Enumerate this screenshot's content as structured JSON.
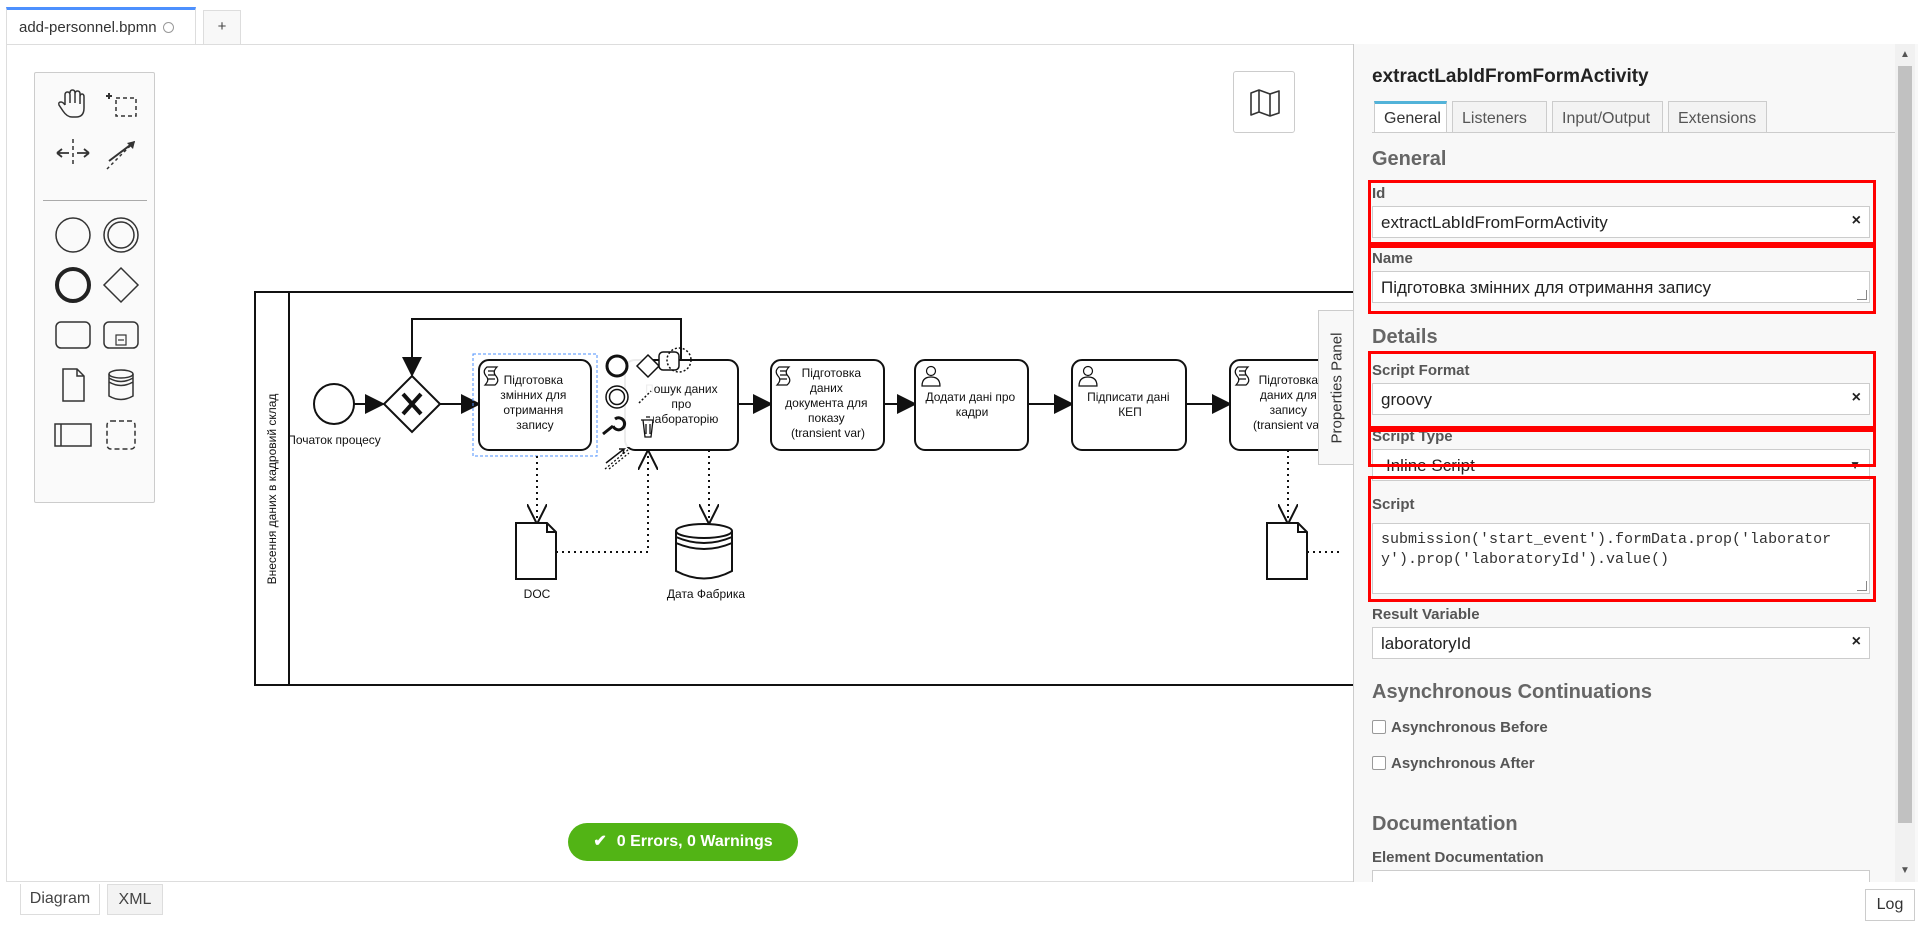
{
  "tabs": {
    "file_name": "add-personnel.bpmn",
    "add_label": "+"
  },
  "palette": {
    "tools": [
      "hand-tool",
      "lasso-tool",
      "space-tool",
      "connect-tool",
      "start-event",
      "intermediate-event",
      "end-event",
      "gateway",
      "task",
      "subprocess",
      "data-object",
      "data-store",
      "pool",
      "group"
    ]
  },
  "diagram": {
    "lane_label": "Внесення даних в кадровий склад",
    "start_event_label": "Початок процесу",
    "task1": [
      "Підготовка",
      "змінних для",
      "отримання",
      "запису"
    ],
    "task2": [
      "Пошук даних",
      "про",
      "лабораторію"
    ],
    "task3": [
      "Підготовка",
      "даних",
      "документа для",
      "показу",
      "(transient var)"
    ],
    "task4": [
      "Додати дані про",
      "кадри"
    ],
    "task5": [
      "Підписати дані",
      "КЕП"
    ],
    "task6": [
      "Підготовка",
      "даних для",
      "запису",
      "(transient var)"
    ],
    "doc_label": "DOC",
    "datastore_label": "Дата Фабрика"
  },
  "status": {
    "text": "0 Errors, 0 Warnings",
    "color": "#52b415"
  },
  "properties_toggle": "Properties Panel",
  "panel": {
    "title": "extractLabIdFromFormActivity",
    "tabs": [
      "General",
      "Listeners",
      "Input/Output",
      "Extensions"
    ],
    "active_tab": "General",
    "sections": {
      "general": "General",
      "details": "Details",
      "async": "Asynchronous Continuations",
      "documentation": "Documentation"
    },
    "fields": {
      "id_label": "Id",
      "id_value": "extractLabIdFromFormActivity",
      "name_label": "Name",
      "name_value": "Підготовка змінних для отримання запису",
      "script_format_label": "Script Format",
      "script_format_value": "groovy",
      "script_type_label": "Script Type",
      "script_type_value": "Inline Script",
      "script_label": "Script",
      "script_value": "submission('start_event').formData.prop('laboratory').prop('laboratoryId').value()",
      "result_variable_label": "Result Variable",
      "result_variable_value": "laboratoryId",
      "async_before_label": "Asynchronous Before",
      "async_after_label": "Asynchronous After",
      "element_documentation_label": "Element Documentation"
    },
    "clear_glyph": "×",
    "highlight_color": "#ff0000"
  },
  "bottom": {
    "diagram_tab": "Diagram",
    "xml_tab": "XML",
    "log_button": "Log"
  }
}
